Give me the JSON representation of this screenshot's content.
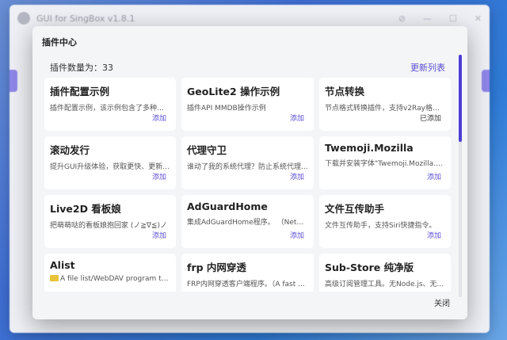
{
  "background": {
    "app_title": "GUI for SingBox v1.8.1",
    "controls": [
      "⊘",
      "—",
      "☐",
      "✕"
    ]
  },
  "modal": {
    "title": "插件中心",
    "count_label": "插件数量为：33",
    "refresh_label": "更新列表",
    "close_label": "关闭"
  },
  "plugins": [
    {
      "title": "插件配置示例",
      "desc": "插件配置示例，该示例包含了多种数据...",
      "action": "添加",
      "installed": false
    },
    {
      "title": "GeoLite2 操作示例",
      "desc": "插件API MMDB操作示例",
      "action": "添加",
      "installed": false
    },
    {
      "title": "节点转换",
      "desc": "节点格式转换插件，支持v2Ray格式...",
      "action": "已添加",
      "installed": true
    },
    {
      "title": "滚动发行",
      "desc": "提升GUI升级体验，获取更快、更新...",
      "action": "添加",
      "installed": false
    },
    {
      "title": "代理守卫",
      "desc": "谁动了我的系统代理？防止系统代理...",
      "action": "添加",
      "installed": false
    },
    {
      "title": "Twemoji.Mozilla",
      "desc": "下载并安装字体\"Twemoji.Mozilla.tt...",
      "action": "添加",
      "installed": false
    },
    {
      "title": "Live2D 看板娘",
      "desc": "把萌萌哒的看板娘抱回家 (ノ≧∇≦)ノ",
      "action": "添加",
      "installed": false
    },
    {
      "title": "AdGuardHome",
      "desc": "集成AdGuardHome程序。 （Netw...",
      "action": "添加",
      "installed": false
    },
    {
      "title": "文件互传助手",
      "desc": "文件互传助手，支持Siri快捷指令。",
      "action": "添加",
      "installed": false
    },
    {
      "title": "Alist",
      "desc": "A file list/WebDAV program th...",
      "action": "",
      "installed": false,
      "folder": true
    },
    {
      "title": "frp 内网穿透",
      "desc": "FRP内网穿透客户端程序。（A fast ...",
      "action": "",
      "installed": false
    },
    {
      "title": "Sub-Store 纯净版",
      "desc": "高级订阅管理工具。无Node.js、无...",
      "action": "",
      "installed": false
    }
  ],
  "colors": {
    "accent": "#5b4fd6",
    "scroll_thumb": "#4b3fd4"
  }
}
